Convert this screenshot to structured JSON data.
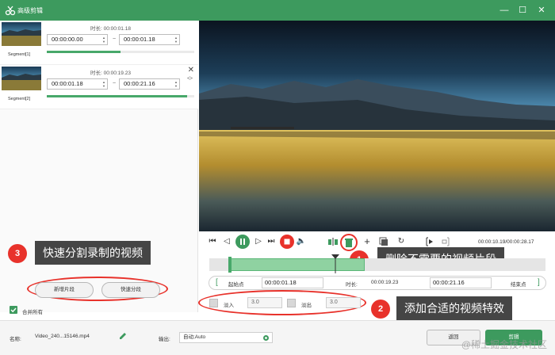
{
  "window": {
    "title": "高级剪辑",
    "minimize": "—",
    "maximize": "☐",
    "close": "✕"
  },
  "segments": [
    {
      "label": "Segment[1]",
      "duration": "时长: 00:00:01.18",
      "start": "00:00:00.00",
      "end": "00:00:01.18",
      "progress": 0.5
    },
    {
      "label": "Segment[2]",
      "duration": "时长: 00:00:19.23",
      "start": "00:00:01.18",
      "end": "00:00:21.16",
      "progress": 0.95
    }
  ],
  "annotations": {
    "a1": {
      "num": "1",
      "text": "删除不需要的视频片段"
    },
    "a2": {
      "num": "2",
      "text": "添加合适的视频特效"
    },
    "a3": {
      "num": "3",
      "text": "快速分割录制的视频"
    }
  },
  "buttons": {
    "new_segment": "新增片段",
    "quick_split": "快速分段",
    "merge_all": "合并所有",
    "back": "返回",
    "edit": "剪辑"
  },
  "controls": {
    "timecode": "00:00:10.19/00:00:28.17"
  },
  "range": {
    "start_label": "起始点",
    "start_value": "00:00:01.18",
    "duration_label": "时长:",
    "duration_value": "00:00:19.23",
    "end_value": "00:00:21.16",
    "end_label": "结束点"
  },
  "fade": {
    "fade_in_label": "淡入",
    "fade_in_value": "3.0",
    "fade_out_label": "淡出",
    "fade_out_value": "3.0"
  },
  "bottom": {
    "name_label": "名称:",
    "name_value": "Video_240...15146.mp4",
    "output_label": "输出:",
    "output_value": "自动;Auto"
  },
  "watermark": "@稀土掘金技术社区",
  "colors": {
    "accent": "#3d9a5e",
    "annotation_red": "#e8322b",
    "annotation_bg": "#454545"
  },
  "icons": {
    "app_logo": "scissors-logo-icon",
    "delete": "trash-icon",
    "add": "plus-icon",
    "copy": "copy-icon",
    "reset": "refresh-icon"
  }
}
